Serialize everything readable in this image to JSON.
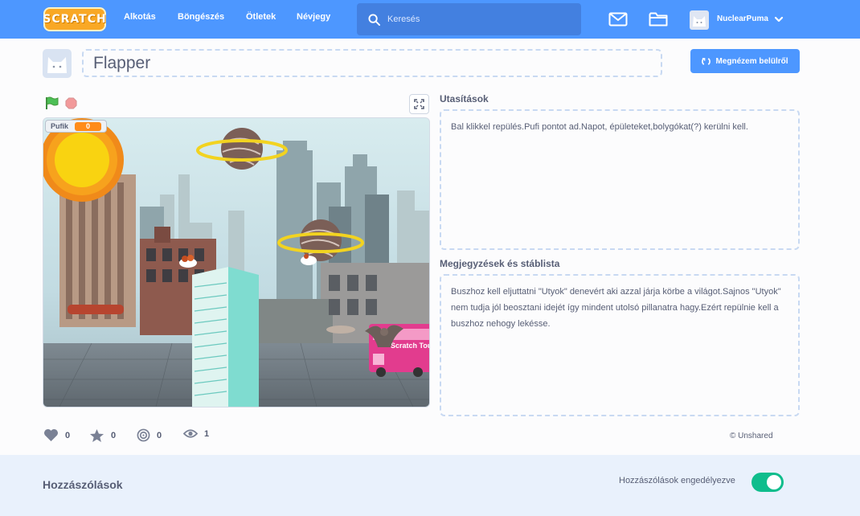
{
  "nav": {
    "logo_text": "SCRATCH",
    "links": [
      "Alkotás",
      "Böngészés",
      "Ötletek",
      "Névjegy"
    ],
    "search_placeholder": "Keresés",
    "username": "NuclearPuma"
  },
  "project": {
    "title": "Flapper",
    "see_inside_label": "Megnézem belülről"
  },
  "stage": {
    "monitor_label": "Pufik",
    "monitor_value": "0",
    "bus_text": "Scratch Tou"
  },
  "instructions": {
    "title": "Utasítások",
    "text": "Bal klikkel repülés.Pufi pontot ad.Napot, épületeket,bolygókat(?) kerülni kell."
  },
  "notes": {
    "title": "Megjegyzések és stáblista",
    "text": "Buszhoz kell eljuttatni \"Utyok\" denevért aki azzal járja körbe a világot.Sajnos \"Utyok\" nem tudja jól beosztani idejét így mindent utolsó pillanatra hagy.Ezért repülnie kell a buszhoz nehogy lekésse."
  },
  "stats": {
    "loves": "0",
    "favorites": "0",
    "remixes": "0",
    "views": "1",
    "shared_status": "© Unshared"
  },
  "comments": {
    "title": "Hozzászólások",
    "toggle_label": "Hozzászólások engedélyezve",
    "toggle_on": true
  },
  "colors": {
    "nav": "#4d97ff",
    "accent": "#4d97ff",
    "toggle": "#0fbd8c",
    "monitor": "#ff8c1a"
  }
}
